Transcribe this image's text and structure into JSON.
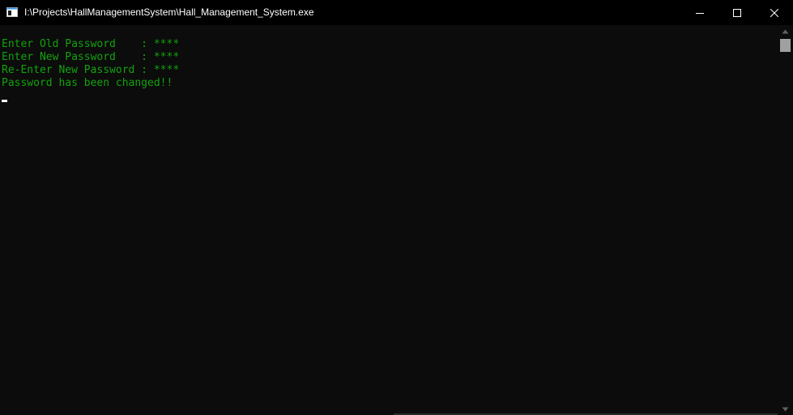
{
  "window": {
    "title": "I:\\Projects\\HallManagementSystem\\Hall_Management_System.exe",
    "icons": {
      "app": "console-app-icon",
      "minimize": "minimize-icon",
      "maximize": "maximize-icon",
      "close": "close-icon"
    }
  },
  "console": {
    "lines": [
      "Enter Old Password    : ****",
      "Enter New Password    : ****",
      "Re-Enter New Password : ****",
      "Password has been changed!!"
    ],
    "text_color": "#13a10e",
    "background": "#0c0c0c"
  },
  "scrollbar": {
    "up_icon": "scroll-up-arrow-icon",
    "down_icon": "scroll-down-arrow-icon"
  }
}
